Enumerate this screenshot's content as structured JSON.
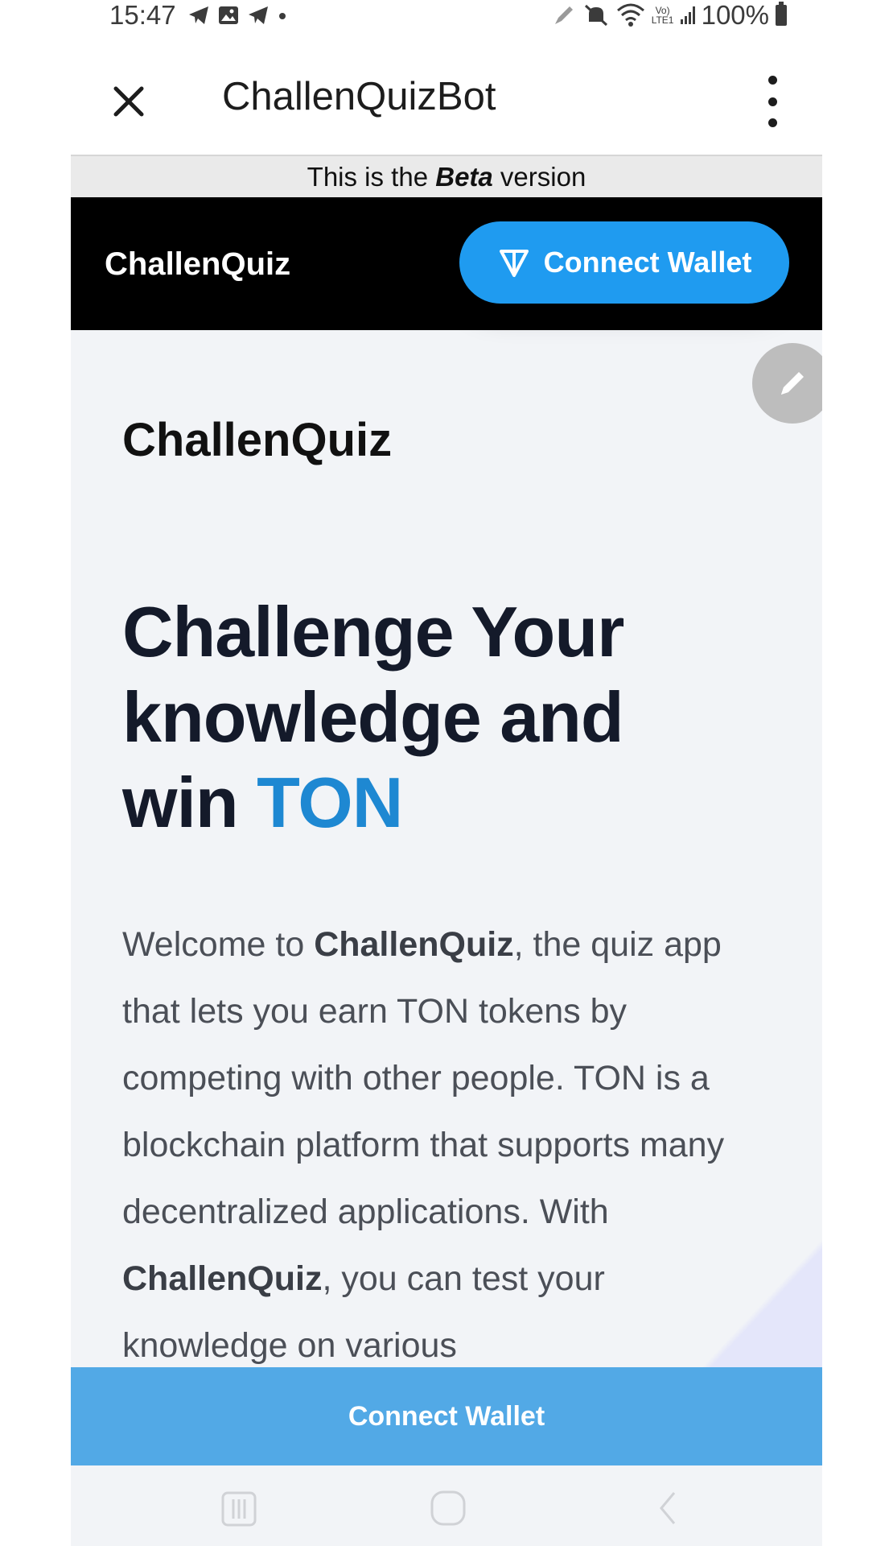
{
  "status_bar": {
    "time": "15:47",
    "battery": "100%",
    "network_label": "Vo) LTE1"
  },
  "telegram_header": {
    "title": "ChallenQuizBot"
  },
  "webapp": {
    "beta_banner": {
      "prefix": "This is the ",
      "emphasis": "Beta",
      "suffix": " version"
    },
    "nav": {
      "brand": "ChallenQuiz",
      "connect_label": "Connect Wallet"
    },
    "brand_heading": "ChallenQuiz",
    "hero": {
      "line_1": "Challenge Your",
      "line_2": "knowledge and",
      "line_3_prefix": "win ",
      "line_3_accent": "TON"
    },
    "intro": {
      "part_1": "Welcome to ",
      "brand_1": "ChallenQuiz",
      "part_2": ", the quiz app that lets you earn TON tokens by competing with other people. TON is a blockchain platform that supports many decentralized applications. With ",
      "brand_2": "ChallenQuiz",
      "part_3": ", you can test your knowledge on various"
    },
    "bottom_button_label": "Connect Wallet"
  },
  "colors": {
    "accent_blue": "#1f9bf0",
    "hero_accent": "#1e88d2",
    "bottom_button": "#52a9e6",
    "nav_background": "#000000"
  }
}
